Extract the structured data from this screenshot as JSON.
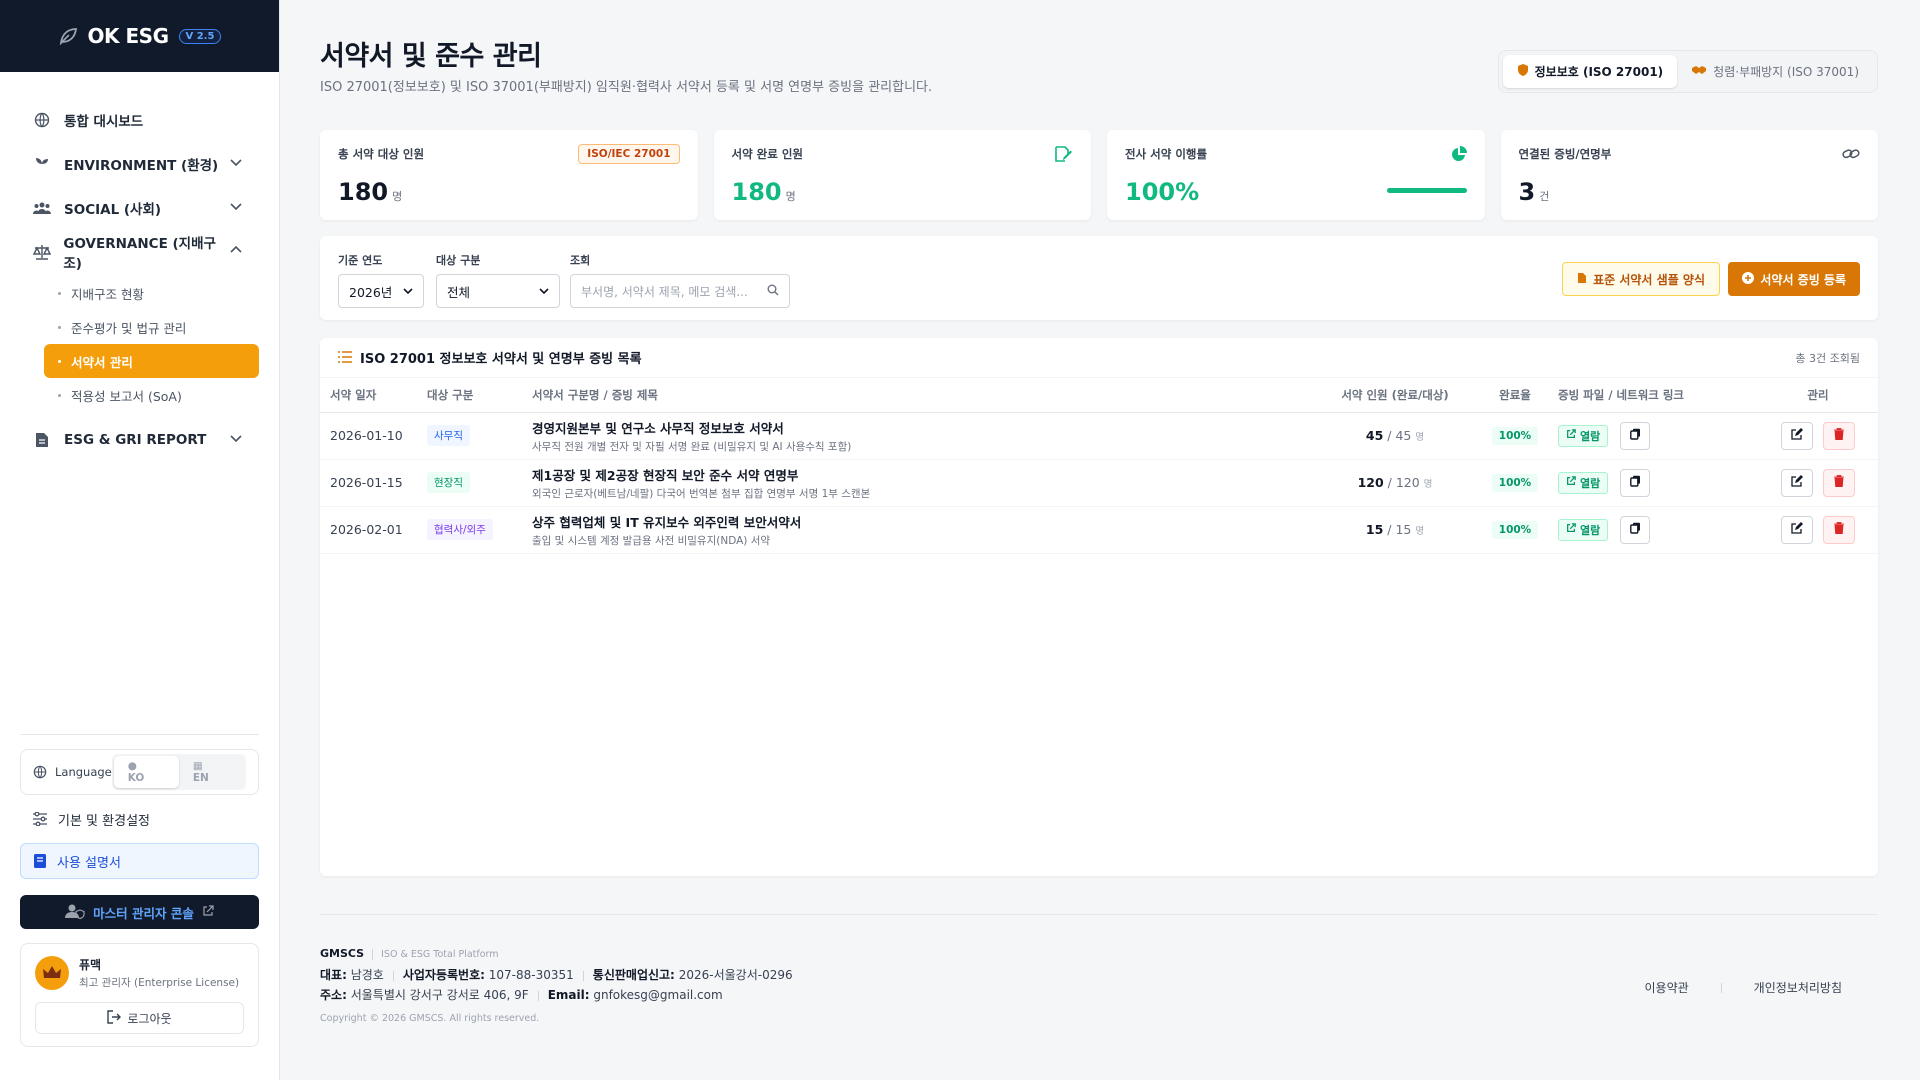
{
  "brand": {
    "name": "OK ESG",
    "version": "V 2.5"
  },
  "nav": {
    "dashboard": "통합 대시보드",
    "environment": "ENVIRONMENT (환경)",
    "social": "SOCIAL (사회)",
    "governance": "GOVERNANCE (지배구조)",
    "governance_items": [
      {
        "label": "지배구조 현황"
      },
      {
        "label": "준수평가 및 법규 관리"
      },
      {
        "label": "서약서 관리"
      },
      {
        "label": "적용성 보고서 (SoA)"
      }
    ],
    "report": "ESG & GRI REPORT"
  },
  "sidebar_bottom": {
    "language_label": "Language",
    "lang_ko": "KO",
    "lang_en": "EN",
    "settings": "기본 및 환경설정",
    "manual": "사용 설명서",
    "master_console": "마스터 관리자 콘솔",
    "user_name": "퓨맥",
    "user_role": "최고 관리자 (Enterprise License)",
    "logout": "로그아웃"
  },
  "header": {
    "title": "서약서 및 준수 관리",
    "subtitle": "ISO 27001(정보보호) 및 ISO 37001(부패방지) 임직원·협력사 서약서 등록 및 서명 연명부 증빙을 관리합니다.",
    "tab_active": "정보보호 (ISO 27001)",
    "tab_other": "청렴·부패방지 (ISO 37001)"
  },
  "cards": [
    {
      "label": "총 서약 대상 인원",
      "value": "180",
      "unit": "명",
      "badge": "ISO/IEC 27001"
    },
    {
      "label": "서약 완료 인원",
      "value": "180",
      "unit": "명"
    },
    {
      "label": "전사 서약 이행률",
      "value": "100%",
      "progress": 1.0
    },
    {
      "label": "연결된 증빙/연명부",
      "value": "3",
      "unit": "건"
    }
  ],
  "filters": {
    "year_label": "기준 연도",
    "year_value": "2026년",
    "type_label": "대상 구분",
    "type_value": "전체",
    "search_label": "조회",
    "search_placeholder": "부서명, 서약서 제목, 메모 검색...",
    "btn_sample": "표준 서약서 샘플 양식",
    "btn_register": "서약서 증빙 등록"
  },
  "list": {
    "title": "ISO 27001 정보보호 서약서 및 연명부 증빙 목록",
    "count": "총 3건 조회됨",
    "columns": [
      "서약 일자",
      "대상 구분",
      "서약서 구분명 / 증빙 제목",
      "서약 인원 (완료/대상)",
      "완료율",
      "증빙 파일 / 네트워크 링크",
      "관리"
    ],
    "view_label": "열람",
    "rows": [
      {
        "date": "2026-01-10",
        "type": "사무직",
        "title": "경영지원본부 및 연구소 사무직 정보보호 서약서",
        "desc": "사무직 전원 개별 전자 및 자필 서명 완료 (비밀유지 및 AI 사용수칙 포함)",
        "done": "45",
        "total": "/ 45",
        "unit": "명",
        "rate": "100%"
      },
      {
        "date": "2026-01-15",
        "type": "현장직",
        "title": "제1공장 및 제2공장 현장직 보안 준수 서약 연명부",
        "desc": "외국인 근로자(베트남/네팔) 다국어 번역본 첨부 집합 연명부 서명 1부 스캔본",
        "done": "120",
        "total": "/ 120",
        "unit": "명",
        "rate": "100%"
      },
      {
        "date": "2026-02-01",
        "type": "협력사/외주",
        "title": "상주 협력업체 및 IT 유지보수 외주인력 보안서약서",
        "desc": "출입 및 시스템 계정 발급용 사전 비밀유지(NDA) 서약",
        "done": "15",
        "total": "/ 15",
        "unit": "명",
        "rate": "100%"
      }
    ]
  },
  "footer": {
    "brand": "GMSCS",
    "brand_sub": "ISO & ESG Total Platform",
    "ceo_label": "대표:",
    "ceo": "남경호",
    "biz_label": "사업자등록번호:",
    "biz": "107-88-30351",
    "mail_order_label": "통신판매업신고:",
    "mail_order": "2026-서울강서-0296",
    "addr_label": "주소:",
    "addr": "서울특별시 강서구 강서로 406, 9F",
    "email_label": "Email:",
    "email": "gnfokesg@gmail.com",
    "copyright": "Copyright © 2026 GMSCS. All rights reserved.",
    "terms": "이용약관",
    "privacy": "개인정보처리방침"
  }
}
